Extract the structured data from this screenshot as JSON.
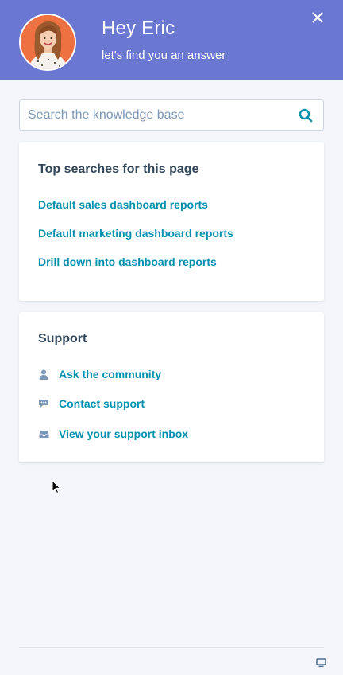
{
  "header": {
    "greeting": "Hey Eric",
    "subtitle": "let's find you an answer",
    "avatar_icon": "user-avatar-photo",
    "close_icon": "close-icon",
    "background_color": "#6a78d1"
  },
  "search": {
    "placeholder": "Search the knowledge base",
    "value": "",
    "icon": "search-icon"
  },
  "top_searches": {
    "title": "Top searches for this page",
    "items": [
      {
        "label": "Default sales dashboard reports"
      },
      {
        "label": "Default marketing dashboard reports"
      },
      {
        "label": "Drill down into dashboard reports"
      }
    ]
  },
  "support": {
    "title": "Support",
    "items": [
      {
        "label": "Ask the community",
        "icon": "person-icon"
      },
      {
        "label": "Contact support",
        "icon": "chat-icon"
      },
      {
        "label": "View your support inbox",
        "icon": "inbox-icon"
      }
    ]
  },
  "footer": {
    "icon": "monitor-icon"
  },
  "colors": {
    "accent": "#6a78d1",
    "link": "#0091ae",
    "text": "#33475b",
    "icon_muted": "#7c98b6",
    "page_bg": "#f4f6fb"
  }
}
